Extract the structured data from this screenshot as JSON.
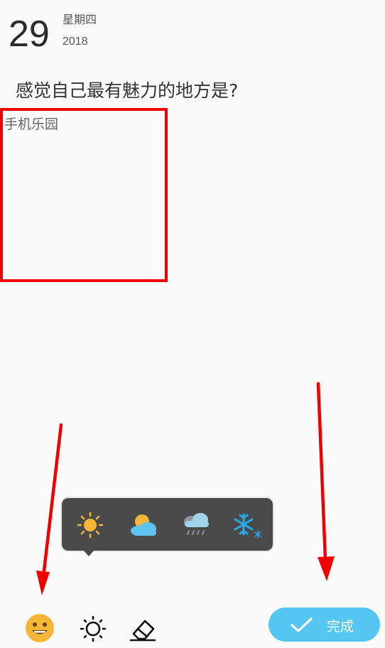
{
  "date": {
    "day": "29",
    "weekday": "星期四",
    "year": "2018"
  },
  "question": "感觉自己最有魅力的地方是?",
  "answer": {
    "text": "手机乐园"
  },
  "weather_options": [
    {
      "icon": "sun-icon"
    },
    {
      "icon": "partly-cloudy-icon"
    },
    {
      "icon": "rain-icon"
    },
    {
      "icon": "snow-icon"
    }
  ],
  "toolbar": {
    "mood_icon": "smiley-icon",
    "weather_icon": "sun-outline-icon",
    "eraser_icon": "eraser-icon"
  },
  "done_button": {
    "label": "完成"
  },
  "colors": {
    "accent": "#54c6f1",
    "annotation_red": "#f00000",
    "popup_bg": "#4a4a4a",
    "mood": "#f5b638"
  }
}
